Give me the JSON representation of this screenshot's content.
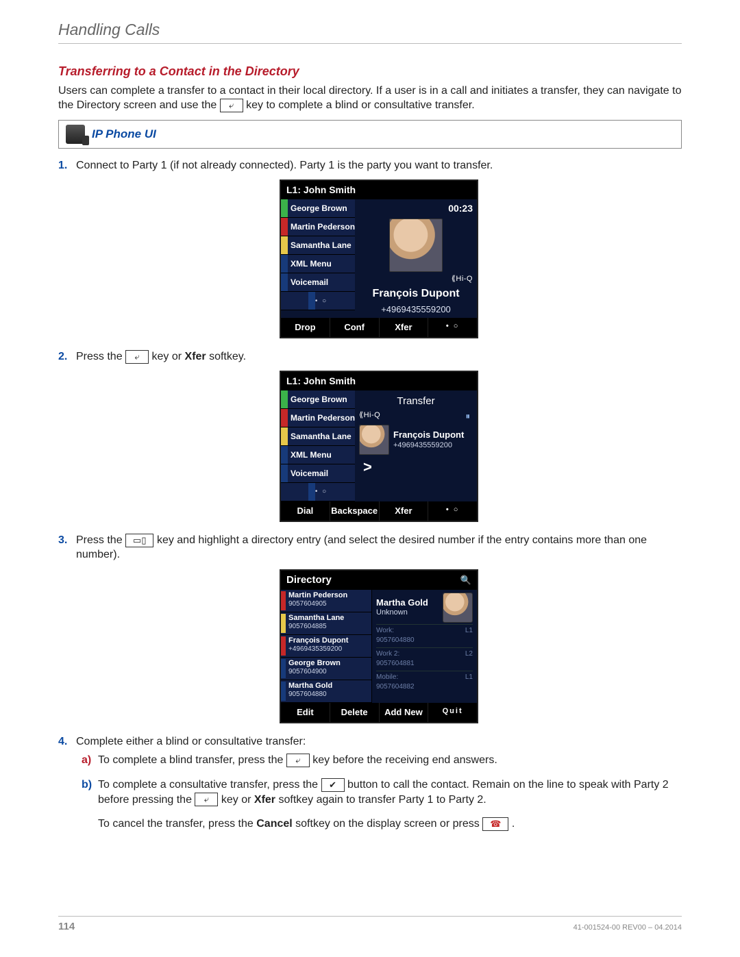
{
  "chapter": "Handling Calls",
  "section_title": "Transferring to a Contact in the Directory",
  "intro_a": "Users can complete a transfer to a contact in their local directory. If a user is in a call and initiates a transfer, they can navigate to the Directory screen and use the",
  "intro_b": "key to complete a blind or consultative transfer.",
  "callout_label": "IP Phone UI",
  "steps": {
    "s1": "Connect to Party 1 (if not already connected). Party 1 is the party you want to transfer.",
    "s2_a": "Press the",
    "s2_b": "key or ",
    "s2_bold": "Xfer",
    "s2_c": " softkey.",
    "s3_a": "Press the",
    "s3_b": "key and highlight a directory entry (and select the desired number if the entry contains more than one number).",
    "s4": "Complete either a blind or consultative transfer:",
    "s4a_a": "To complete a blind transfer, press the",
    "s4a_b": "key before the receiving end answers.",
    "s4b_a": "To complete a consultative transfer, press the",
    "s4b_b": "button to call the contact. Remain on the line to speak with Party 2 before pressing the",
    "s4b_c": "key or ",
    "s4b_bold": "Xfer",
    "s4b_d": " softkey again to transfer Party 1 to Party 2.",
    "cancel_a": "To cancel the transfer, press the ",
    "cancel_bold": "Cancel",
    "cancel_b": " softkey on the display screen or press",
    "period": "."
  },
  "key_icons": {
    "xfer": "⤶",
    "book": "▭▯",
    "check": "✔",
    "hangup": "☎"
  },
  "screen1": {
    "title": "L1: John Smith",
    "left": [
      {
        "color": "green",
        "label": "George Brown"
      },
      {
        "color": "red",
        "label": "Martin Pederson"
      },
      {
        "color": "yellow",
        "label": "Samantha Lane"
      },
      {
        "color": "blue",
        "label": "XML Menu"
      },
      {
        "color": "blue",
        "label": "Voicemail"
      }
    ],
    "timer": "00:23",
    "hiq": "⟪Hi-Q",
    "name": "François Dupont",
    "number": "+4969435559200",
    "softkeys": [
      "Drop",
      "Conf",
      "Xfer",
      "• ○"
    ]
  },
  "screen2": {
    "title": "L1: John Smith",
    "left": [
      {
        "color": "green",
        "label": "George Brown"
      },
      {
        "color": "red",
        "label": "Martin Pederson"
      },
      {
        "color": "yellow",
        "label": "Samantha Lane"
      },
      {
        "color": "blue",
        "label": "XML Menu"
      },
      {
        "color": "blue",
        "label": "Voicemail"
      }
    ],
    "header": "Transfer",
    "hiq": "⟪Hi-Q",
    "hold": "⏸",
    "name": "François Dupont",
    "number": "+4969435559200",
    "chev": ">",
    "softkeys": [
      "Dial",
      "Backspace",
      "Xfer",
      "• ○"
    ]
  },
  "screen3": {
    "title": "Directory",
    "mag": "🔍",
    "left": [
      {
        "color": "red",
        "name": "Martin Pederson",
        "num": "9057604905"
      },
      {
        "color": "yellow",
        "name": "Samantha Lane",
        "num": "9057604885"
      },
      {
        "color": "red",
        "name": "François Dupont",
        "num": "+4969435359200"
      },
      {
        "color": "blue",
        "name": "George Brown",
        "num": "9057604900"
      },
      {
        "color": "blue",
        "name": "Martha Gold",
        "num": "9057604880"
      }
    ],
    "selected": {
      "name": "Martha Gold",
      "presence": "Unknown"
    },
    "numbers": [
      {
        "label": "Work:",
        "num": "9057604880",
        "ln": "L1"
      },
      {
        "label": "Work 2:",
        "num": "9057604881",
        "ln": "L2"
      },
      {
        "label": "Mobile:",
        "num": "9057604882",
        "ln": "L1"
      }
    ],
    "softkeys": [
      "Edit",
      "Delete",
      "Add New",
      "Quit"
    ]
  },
  "footer": {
    "page": "114",
    "rev": "41-001524-00 REV00 – 04.2014"
  }
}
